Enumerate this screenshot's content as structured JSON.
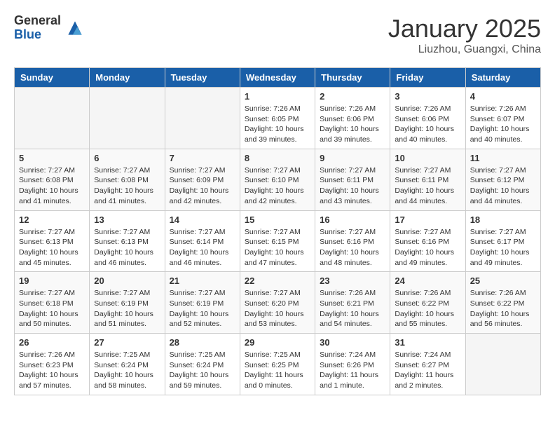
{
  "logo": {
    "general": "General",
    "blue": "Blue"
  },
  "header": {
    "month": "January 2025",
    "location": "Liuzhou, Guangxi, China"
  },
  "weekdays": [
    "Sunday",
    "Monday",
    "Tuesday",
    "Wednesday",
    "Thursday",
    "Friday",
    "Saturday"
  ],
  "weeks": [
    [
      {
        "day": "",
        "info": ""
      },
      {
        "day": "",
        "info": ""
      },
      {
        "day": "",
        "info": ""
      },
      {
        "day": "1",
        "info": "Sunrise: 7:26 AM\nSunset: 6:05 PM\nDaylight: 10 hours\nand 39 minutes."
      },
      {
        "day": "2",
        "info": "Sunrise: 7:26 AM\nSunset: 6:06 PM\nDaylight: 10 hours\nand 39 minutes."
      },
      {
        "day": "3",
        "info": "Sunrise: 7:26 AM\nSunset: 6:06 PM\nDaylight: 10 hours\nand 40 minutes."
      },
      {
        "day": "4",
        "info": "Sunrise: 7:26 AM\nSunset: 6:07 PM\nDaylight: 10 hours\nand 40 minutes."
      }
    ],
    [
      {
        "day": "5",
        "info": "Sunrise: 7:27 AM\nSunset: 6:08 PM\nDaylight: 10 hours\nand 41 minutes."
      },
      {
        "day": "6",
        "info": "Sunrise: 7:27 AM\nSunset: 6:08 PM\nDaylight: 10 hours\nand 41 minutes."
      },
      {
        "day": "7",
        "info": "Sunrise: 7:27 AM\nSunset: 6:09 PM\nDaylight: 10 hours\nand 42 minutes."
      },
      {
        "day": "8",
        "info": "Sunrise: 7:27 AM\nSunset: 6:10 PM\nDaylight: 10 hours\nand 42 minutes."
      },
      {
        "day": "9",
        "info": "Sunrise: 7:27 AM\nSunset: 6:11 PM\nDaylight: 10 hours\nand 43 minutes."
      },
      {
        "day": "10",
        "info": "Sunrise: 7:27 AM\nSunset: 6:11 PM\nDaylight: 10 hours\nand 44 minutes."
      },
      {
        "day": "11",
        "info": "Sunrise: 7:27 AM\nSunset: 6:12 PM\nDaylight: 10 hours\nand 44 minutes."
      }
    ],
    [
      {
        "day": "12",
        "info": "Sunrise: 7:27 AM\nSunset: 6:13 PM\nDaylight: 10 hours\nand 45 minutes."
      },
      {
        "day": "13",
        "info": "Sunrise: 7:27 AM\nSunset: 6:13 PM\nDaylight: 10 hours\nand 46 minutes."
      },
      {
        "day": "14",
        "info": "Sunrise: 7:27 AM\nSunset: 6:14 PM\nDaylight: 10 hours\nand 46 minutes."
      },
      {
        "day": "15",
        "info": "Sunrise: 7:27 AM\nSunset: 6:15 PM\nDaylight: 10 hours\nand 47 minutes."
      },
      {
        "day": "16",
        "info": "Sunrise: 7:27 AM\nSunset: 6:16 PM\nDaylight: 10 hours\nand 48 minutes."
      },
      {
        "day": "17",
        "info": "Sunrise: 7:27 AM\nSunset: 6:16 PM\nDaylight: 10 hours\nand 49 minutes."
      },
      {
        "day": "18",
        "info": "Sunrise: 7:27 AM\nSunset: 6:17 PM\nDaylight: 10 hours\nand 49 minutes."
      }
    ],
    [
      {
        "day": "19",
        "info": "Sunrise: 7:27 AM\nSunset: 6:18 PM\nDaylight: 10 hours\nand 50 minutes."
      },
      {
        "day": "20",
        "info": "Sunrise: 7:27 AM\nSunset: 6:19 PM\nDaylight: 10 hours\nand 51 minutes."
      },
      {
        "day": "21",
        "info": "Sunrise: 7:27 AM\nSunset: 6:19 PM\nDaylight: 10 hours\nand 52 minutes."
      },
      {
        "day": "22",
        "info": "Sunrise: 7:27 AM\nSunset: 6:20 PM\nDaylight: 10 hours\nand 53 minutes."
      },
      {
        "day": "23",
        "info": "Sunrise: 7:26 AM\nSunset: 6:21 PM\nDaylight: 10 hours\nand 54 minutes."
      },
      {
        "day": "24",
        "info": "Sunrise: 7:26 AM\nSunset: 6:22 PM\nDaylight: 10 hours\nand 55 minutes."
      },
      {
        "day": "25",
        "info": "Sunrise: 7:26 AM\nSunset: 6:22 PM\nDaylight: 10 hours\nand 56 minutes."
      }
    ],
    [
      {
        "day": "26",
        "info": "Sunrise: 7:26 AM\nSunset: 6:23 PM\nDaylight: 10 hours\nand 57 minutes."
      },
      {
        "day": "27",
        "info": "Sunrise: 7:25 AM\nSunset: 6:24 PM\nDaylight: 10 hours\nand 58 minutes."
      },
      {
        "day": "28",
        "info": "Sunrise: 7:25 AM\nSunset: 6:24 PM\nDaylight: 10 hours\nand 59 minutes."
      },
      {
        "day": "29",
        "info": "Sunrise: 7:25 AM\nSunset: 6:25 PM\nDaylight: 11 hours\nand 0 minutes."
      },
      {
        "day": "30",
        "info": "Sunrise: 7:24 AM\nSunset: 6:26 PM\nDaylight: 11 hours\nand 1 minute."
      },
      {
        "day": "31",
        "info": "Sunrise: 7:24 AM\nSunset: 6:27 PM\nDaylight: 11 hours\nand 2 minutes."
      },
      {
        "day": "",
        "info": ""
      }
    ]
  ]
}
